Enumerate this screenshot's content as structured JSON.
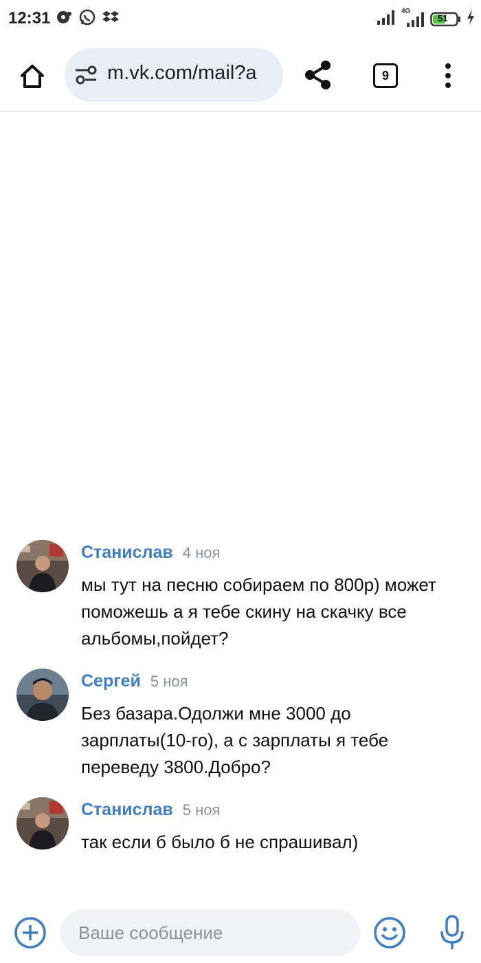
{
  "status_bar": {
    "time": "12:31",
    "network_label": "4G",
    "battery_level": "51",
    "icons": [
      "media-icon",
      "whatsapp-icon",
      "dropbox-icon",
      "signal-icon",
      "signal-4g-icon",
      "battery-icon",
      "charging-icon"
    ]
  },
  "browser": {
    "url": "m.vk.com/mail?a",
    "tab_count": "9",
    "icons": [
      "home-icon",
      "site-settings-icon",
      "share-icon",
      "tabs-icon",
      "more-menu-icon"
    ]
  },
  "messages": [
    {
      "author": "Станислав",
      "date": "4 ноя",
      "text": "мы тут на песню собираем по 800р) может поможешь а я тебе скину на скачку все альбомы,пойдет?"
    },
    {
      "author": "Сергей",
      "date": "5 ноя",
      "text": "Без базара.Одолжи мне 3000 до зарплаты(10-го), а с зарплаты я тебе переведу 3800.Добро?"
    },
    {
      "author": "Станислав",
      "date": "5 ноя",
      "text": "так если б было б не спрашивал)"
    }
  ],
  "composer": {
    "placeholder": "Ваше сообщение",
    "icons": [
      "add-icon",
      "emoji-icon",
      "microphone-icon"
    ]
  },
  "colors": {
    "accent": "#3f7ec2",
    "author": "#3f7ec2",
    "date": "#8b9199",
    "url_bar_bg": "#e9eef6",
    "input_bg": "#f0f2f5",
    "battery_green": "#5cc04a"
  }
}
